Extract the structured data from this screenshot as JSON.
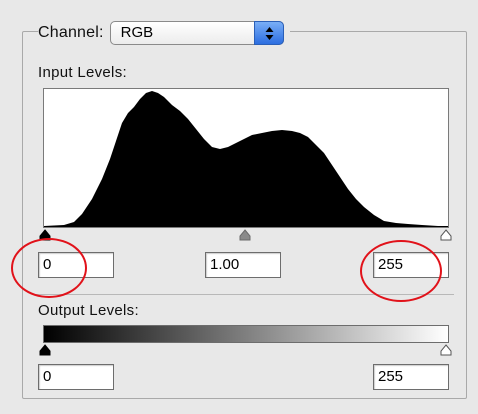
{
  "channel": {
    "label": "Channel:",
    "selected": "RGB",
    "stepper_icon": "up-down-arrows-icon"
  },
  "input_levels": {
    "label": "Input Levels:",
    "black": "0",
    "gamma": "1.00",
    "white": "255"
  },
  "output_levels": {
    "label": "Output Levels:",
    "black": "0",
    "white": "255"
  },
  "colors": {
    "accent": "#2c6ee0",
    "annotation": "#e1121a",
    "histogram": "#000000",
    "gamma_slider": "#8a8a8a"
  },
  "annotations": [
    "black-input-field-highlight",
    "white-input-field-highlight"
  ]
}
